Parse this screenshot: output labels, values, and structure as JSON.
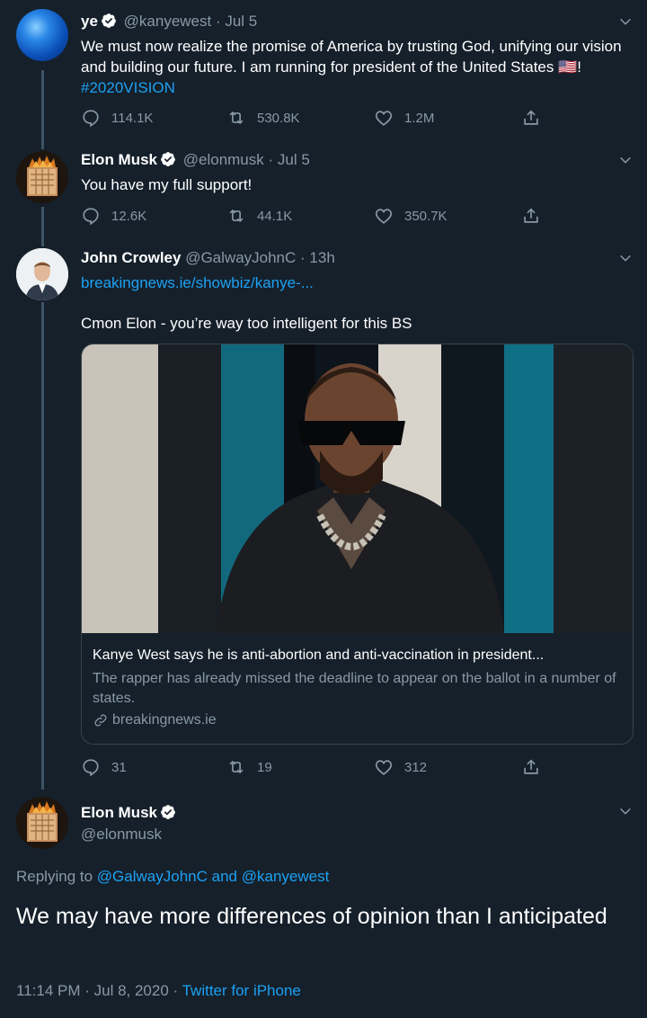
{
  "tweets": [
    {
      "name": "ye",
      "handle": "@kanyewest",
      "time": "· Jul 5",
      "text_main": "We must now realize the promise of America by trusting God, unifying our vision and building our future. I am running for president of the United States",
      "flag": "🇺🇸",
      "text_after_flag": "!",
      "hashtag": "#2020VISION",
      "replies": "114.1K",
      "retweets": "530.8K",
      "likes": "1.2M"
    },
    {
      "name": "Elon Musk",
      "handle": "@elonmusk",
      "time": "· Jul 5",
      "text": "You have my full support!",
      "replies": "12.6K",
      "retweets": "44.1K",
      "likes": "350.7K"
    },
    {
      "name": "John Crowley",
      "handle": "@GalwayJohnC",
      "time": "· 13h",
      "link": "breakingnews.ie/showbiz/kanye-...",
      "text": "Cmon Elon - you’re way too intelligent for this BS",
      "replies": "31",
      "retweets": "19",
      "likes": "312",
      "card": {
        "title": "Kanye West says he is anti-abortion and anti-vaccination in president...",
        "description": "The rapper has already missed the deadline to appear on the ballot in a number of states.",
        "domain": "breakingnews.ie"
      }
    }
  ],
  "main_tweet": {
    "name": "Elon Musk",
    "handle": "@elonmusk",
    "replying_prefix": "Replying to",
    "replying_user1": "@GalwayJohnC",
    "replying_and": "and",
    "replying_user2": "@kanyewest",
    "text": "We may have more differences of opinion than I anticipated",
    "time": "11:14 PM · Jul 8, 2020 ·",
    "client": "Twitter for iPhone"
  },
  "colors": {
    "background": "#15202b",
    "accent": "#1da1f2",
    "secondary_text": "#8899a6",
    "thread_line": "#3d5466",
    "border": "#38444d"
  },
  "icons": [
    "reply-icon",
    "retweet-icon",
    "like-icon",
    "share-icon",
    "verified-icon",
    "chevron-down-icon",
    "link-icon"
  ]
}
